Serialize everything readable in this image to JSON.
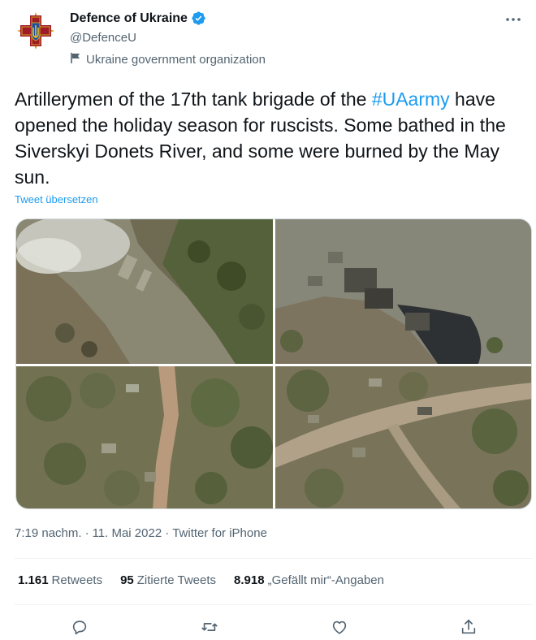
{
  "author": {
    "display_name": "Defence of Ukraine",
    "handle": "@DefenceU",
    "label": "Ukraine government organization"
  },
  "tweet": {
    "text_before": "Artillerymen of the 17th tank brigade of the ",
    "hashtag": "#UAarmy",
    "text_after": " have opened the holiday season for ruscists. Some bathed in the Siverskyi Donets River, and some were burned by the May sun.",
    "translate_label": "Tweet übersetzen"
  },
  "meta": {
    "time": "7:19 nachm.",
    "separator": "·",
    "date": "11. Mai 2022",
    "source": "Twitter for iPhone"
  },
  "stats": {
    "retweets_count": "1.161",
    "retweets_label": "Retweets",
    "quotes_count": "95",
    "quotes_label": "Zitierte Tweets",
    "likes_count": "8.918",
    "likes_label": "„Gefällt mir“-Angaben"
  },
  "colors": {
    "accent": "#1d9bf0",
    "text": "#0f1419",
    "muted": "#536471",
    "emblem_red": "#9e1b2a",
    "emblem_gold": "#d4a017"
  },
  "icons": {
    "verified": "verified-badge-icon",
    "government": "flag-icon",
    "more": "more-dots-icon",
    "reply": "reply-icon",
    "retweet": "retweet-icon",
    "like": "heart-icon",
    "share": "share-icon"
  }
}
